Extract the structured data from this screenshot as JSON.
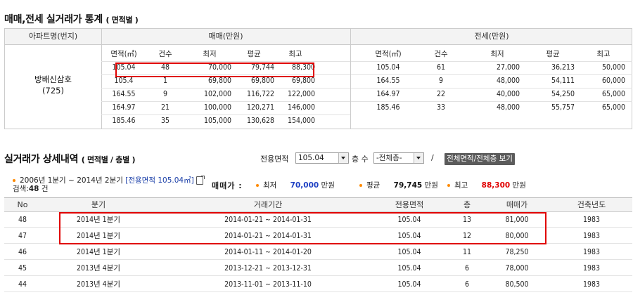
{
  "section1": {
    "title": "매매,전세 실거래가 통계",
    "subtitle": "( 면적별 )",
    "col_apartment": "아파트명(번지)",
    "col_trade": "매매(만원)",
    "col_lease": "전세(만원)",
    "apartment_name": "방배신삼호",
    "apartment_lot": "(725)",
    "trade_headers": [
      "면적(㎡)",
      "건수",
      "최저",
      "평균",
      "최고"
    ],
    "lease_headers": [
      "면적(㎡)",
      "건수",
      "최저",
      "평균",
      "최고"
    ],
    "trade_rows": [
      [
        "105.04",
        "48",
        "70,000",
        "79,744",
        "88,300"
      ],
      [
        "105.4",
        "1",
        "69,800",
        "69,800",
        "69,800"
      ],
      [
        "164.55",
        "9",
        "102,000",
        "116,722",
        "122,000"
      ],
      [
        "164.97",
        "21",
        "100,000",
        "120,271",
        "146,000"
      ],
      [
        "185.46",
        "35",
        "105,000",
        "130,628",
        "154,000"
      ]
    ],
    "lease_rows": [
      [
        "105.04",
        "61",
        "27,000",
        "36,213",
        "50,000"
      ],
      [
        "164.55",
        "9",
        "48,000",
        "54,111",
        "60,000"
      ],
      [
        "164.97",
        "22",
        "40,000",
        "54,250",
        "65,000"
      ],
      [
        "185.46",
        "33",
        "48,000",
        "55,757",
        "65,000"
      ]
    ]
  },
  "section2": {
    "title": "실거래가 상세내역",
    "subtitle": "( 면적별 / 층별 )",
    "area_label": "전용면적",
    "area_value": "105.04",
    "floor_label": "층 수",
    "floor_value": "-전체층-",
    "slash": "/",
    "view_all_button": "전체면적/전체층 보기",
    "period_text": "2006년 1분기 ~ 2014년 2분기",
    "area_link": "[전용면적 105.04㎡]",
    "search_count_label": "검색:",
    "search_count_value": "48",
    "search_count_unit": "건",
    "price_label": "매매가 :",
    "min_label": "최저",
    "min_value": "70,000",
    "avg_label": "평균",
    "avg_value": "79,745",
    "max_label": "최고",
    "max_value": "88,300",
    "unit": "만원",
    "headers": [
      "No",
      "분기",
      "거래기간",
      "전용면적",
      "층",
      "매매가",
      "건축년도"
    ],
    "rows": [
      [
        "48",
        "2014년 1분기",
        "2014-01-21 ~ 2014-01-31",
        "105.04",
        "13",
        "81,000",
        "1983"
      ],
      [
        "47",
        "2014년 1분기",
        "2014-01-21 ~ 2014-01-31",
        "105.04",
        "12",
        "80,000",
        "1983"
      ],
      [
        "46",
        "2014년 1분기",
        "2014-01-11 ~ 2014-01-20",
        "105.04",
        "11",
        "78,250",
        "1983"
      ],
      [
        "45",
        "2013년 4분기",
        "2013-12-21 ~ 2013-12-31",
        "105.04",
        "6",
        "78,000",
        "1983"
      ],
      [
        "44",
        "2013년 4분기",
        "2013-11-01 ~ 2013-11-10",
        "105.04",
        "6",
        "80,500",
        "1983"
      ]
    ]
  },
  "colors": {
    "highlight_border": "#e00000",
    "min_price": "#1d3fc3",
    "max_price": "#e00000",
    "bullet": "#ff8a00",
    "link": "#1b3fa8"
  }
}
